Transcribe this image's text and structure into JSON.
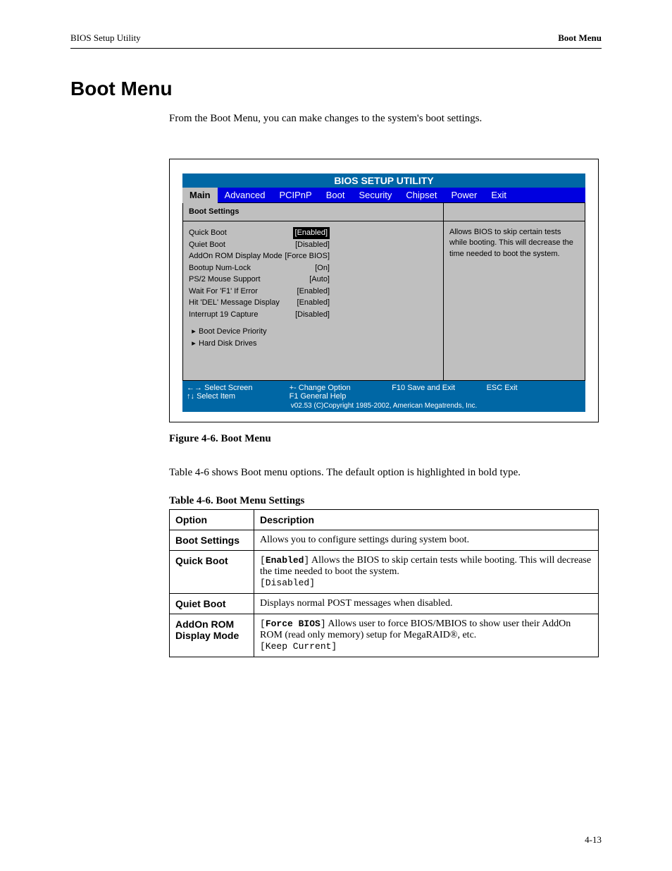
{
  "header": {
    "left": "BIOS Setup Utility",
    "right": "Boot Menu"
  },
  "title": "Boot Menu",
  "intro": "From the Boot Menu, you can make changes to the system's boot settings.",
  "figure": {
    "bios_title": "BIOS SETUP UTILITY",
    "tabs": [
      "Main",
      "Advanced",
      "PCIPnP",
      "Boot",
      "Security",
      "Chipset",
      "Power",
      "Exit"
    ],
    "active_tab": "Main",
    "left_rows": [
      {
        "label": "Boot Settings",
        "value": ""
      },
      {
        "label": "Quick Boot",
        "value": "[Enabled]"
      },
      {
        "label": "Quiet Boot",
        "value": "[Disabled]"
      },
      {
        "label": "AddOn ROM Display Mode",
        "value": "[Force BIOS]"
      },
      {
        "label": "Bootup Num-Lock",
        "value": "[On]"
      },
      {
        "label": "PS/2 Mouse Support",
        "value": "[Auto]"
      },
      {
        "label": "Wait For 'F1' If Error",
        "value": "[Enabled]"
      },
      {
        "label": "Hit 'DEL' Message Display",
        "value": "[Enabled]"
      },
      {
        "label": "Interrupt 19 Capture",
        "value": "[Disabled]"
      },
      {
        "label": "Boot Device Priority",
        "value": ""
      },
      {
        "label": "Hard Disk Drives",
        "value": ""
      }
    ],
    "right_head": "",
    "right_body": "Allows BIOS to skip certain tests while booting. This will decrease the time needed to boot the system.",
    "footer_cols": [
      "v02.53 (C)Copyright 1985-2002, American Megatrends, Inc.",
      "Select Screen",
      "Select Item",
      "Change Option",
      "General Help",
      "Save and Exit",
      "Exit"
    ],
    "footer_keys": [
      "",
      "←→",
      "↑↓",
      "+-",
      "F1",
      "F10",
      "ESC"
    ]
  },
  "figcap": "Figure 4-6. Boot Menu",
  "tbl_intro": "Table 4-6 shows Boot menu options. The default option is highlighted in bold type.",
  "tbl_cap": "Table 4-6. Boot Menu Settings",
  "tbl": {
    "head": [
      "Option",
      "Description"
    ],
    "rows": [
      {
        "opt": "Boot Settings",
        "desc": "Allows you to configure settings during system boot."
      },
      {
        "opt": "Quick Boot",
        "desc": "[<b>Enabled</b>] Allows the BIOS to skip certain tests while booting. This will decrease the time needed to boot the system.<br>[Disabled]"
      },
      {
        "opt": "Quiet Boot",
        "desc": "Displays normal POST messages when disabled."
      },
      {
        "opt": "AddOn ROM Display Mode",
        "desc": "[<b>Force BIOS</b>] Allows user to force BIOS/MBIOS to show user their AddOn ROM (read only memory) setup for MegaRAID<span class='reg'>®</span>, etc.<br>[Keep Current]"
      }
    ]
  },
  "page_no": "4-13"
}
